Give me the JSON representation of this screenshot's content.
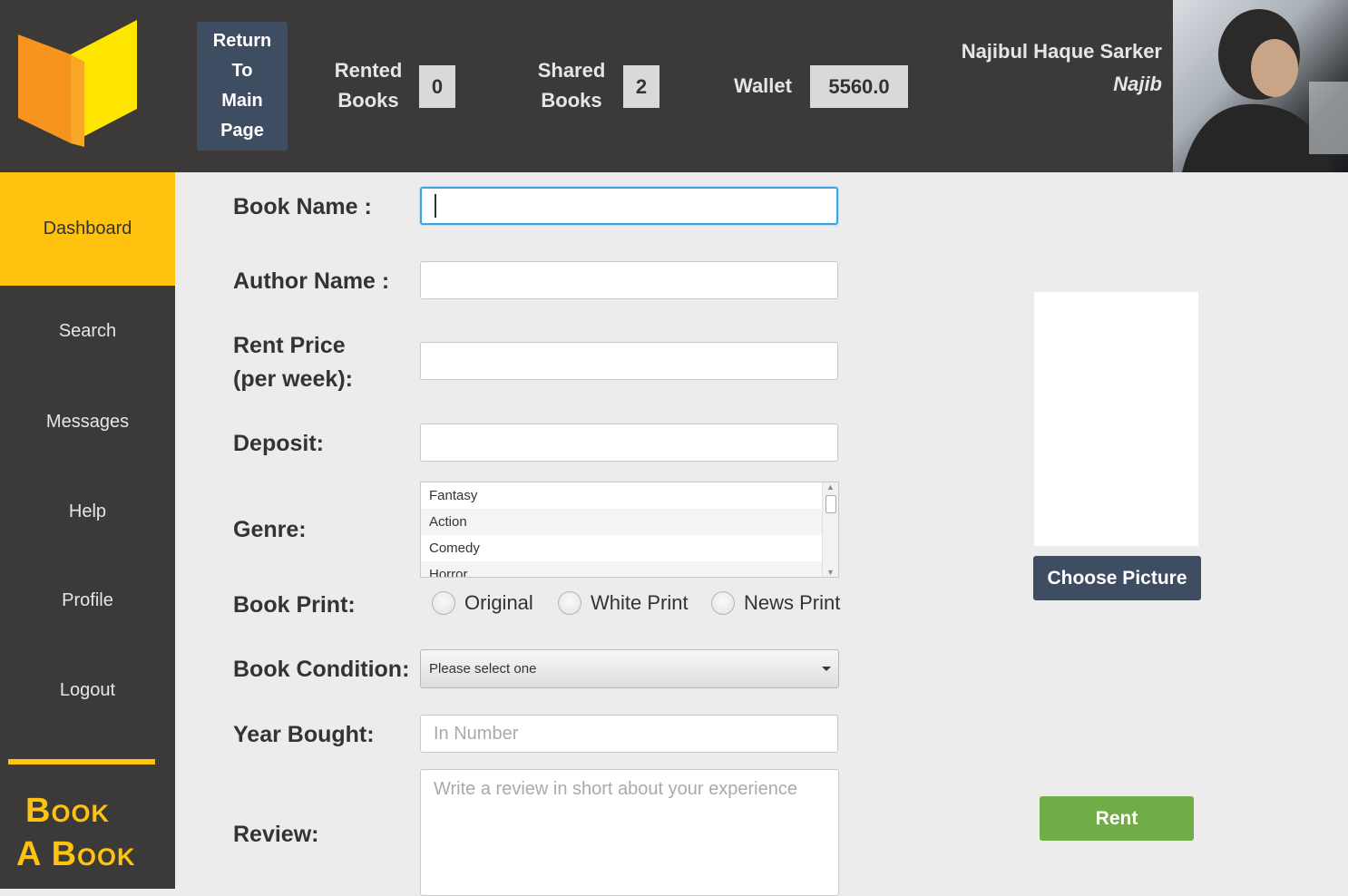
{
  "header": {
    "return_button": "Return To Main Page",
    "rented_label_1": "Rented",
    "rented_label_2": "Books",
    "rented_count": "0",
    "shared_label_1": "Shared",
    "shared_label_2": "Books",
    "shared_count": "2",
    "wallet_label": "Wallet",
    "wallet_value": "5560.0",
    "user_full_name": "Najibul Haque Sarker",
    "user_nickname": "Najib"
  },
  "sidebar": {
    "items": [
      {
        "label": "Dashboard",
        "active": true
      },
      {
        "label": "Search"
      },
      {
        "label": "Messages"
      },
      {
        "label": "Help"
      },
      {
        "label": "Profile"
      },
      {
        "label": "Logout"
      }
    ],
    "brand_line1": "Book",
    "brand_line2": "A Book"
  },
  "form": {
    "book_name_label": "Book Name :",
    "author_name_label": "Author Name :",
    "rent_price_label_1": "Rent Price",
    "rent_price_label_2": "(per week):",
    "deposit_label": "Deposit:",
    "genre_label": "Genre:",
    "genres": [
      "Fantasy",
      "Action",
      "Comedy",
      "Horror"
    ],
    "book_print_label": "Book Print:",
    "print_options": [
      "Original",
      "White Print",
      "News Print"
    ],
    "condition_label": "Book Condition:",
    "condition_value": "Please select one",
    "year_label": "Year Bought:",
    "year_placeholder": "In Number",
    "review_label": "Review:",
    "review_placeholder": "Write a review in short about your experience"
  },
  "actions": {
    "choose_picture": "Choose Picture",
    "rent": "Rent"
  },
  "colors": {
    "dark_bg": "#3b3a39",
    "accent_yellow": "#ffc20e",
    "button_slate": "#3f4d63",
    "rent_green": "#70ad47",
    "focus_blue": "#3aa5e0"
  }
}
